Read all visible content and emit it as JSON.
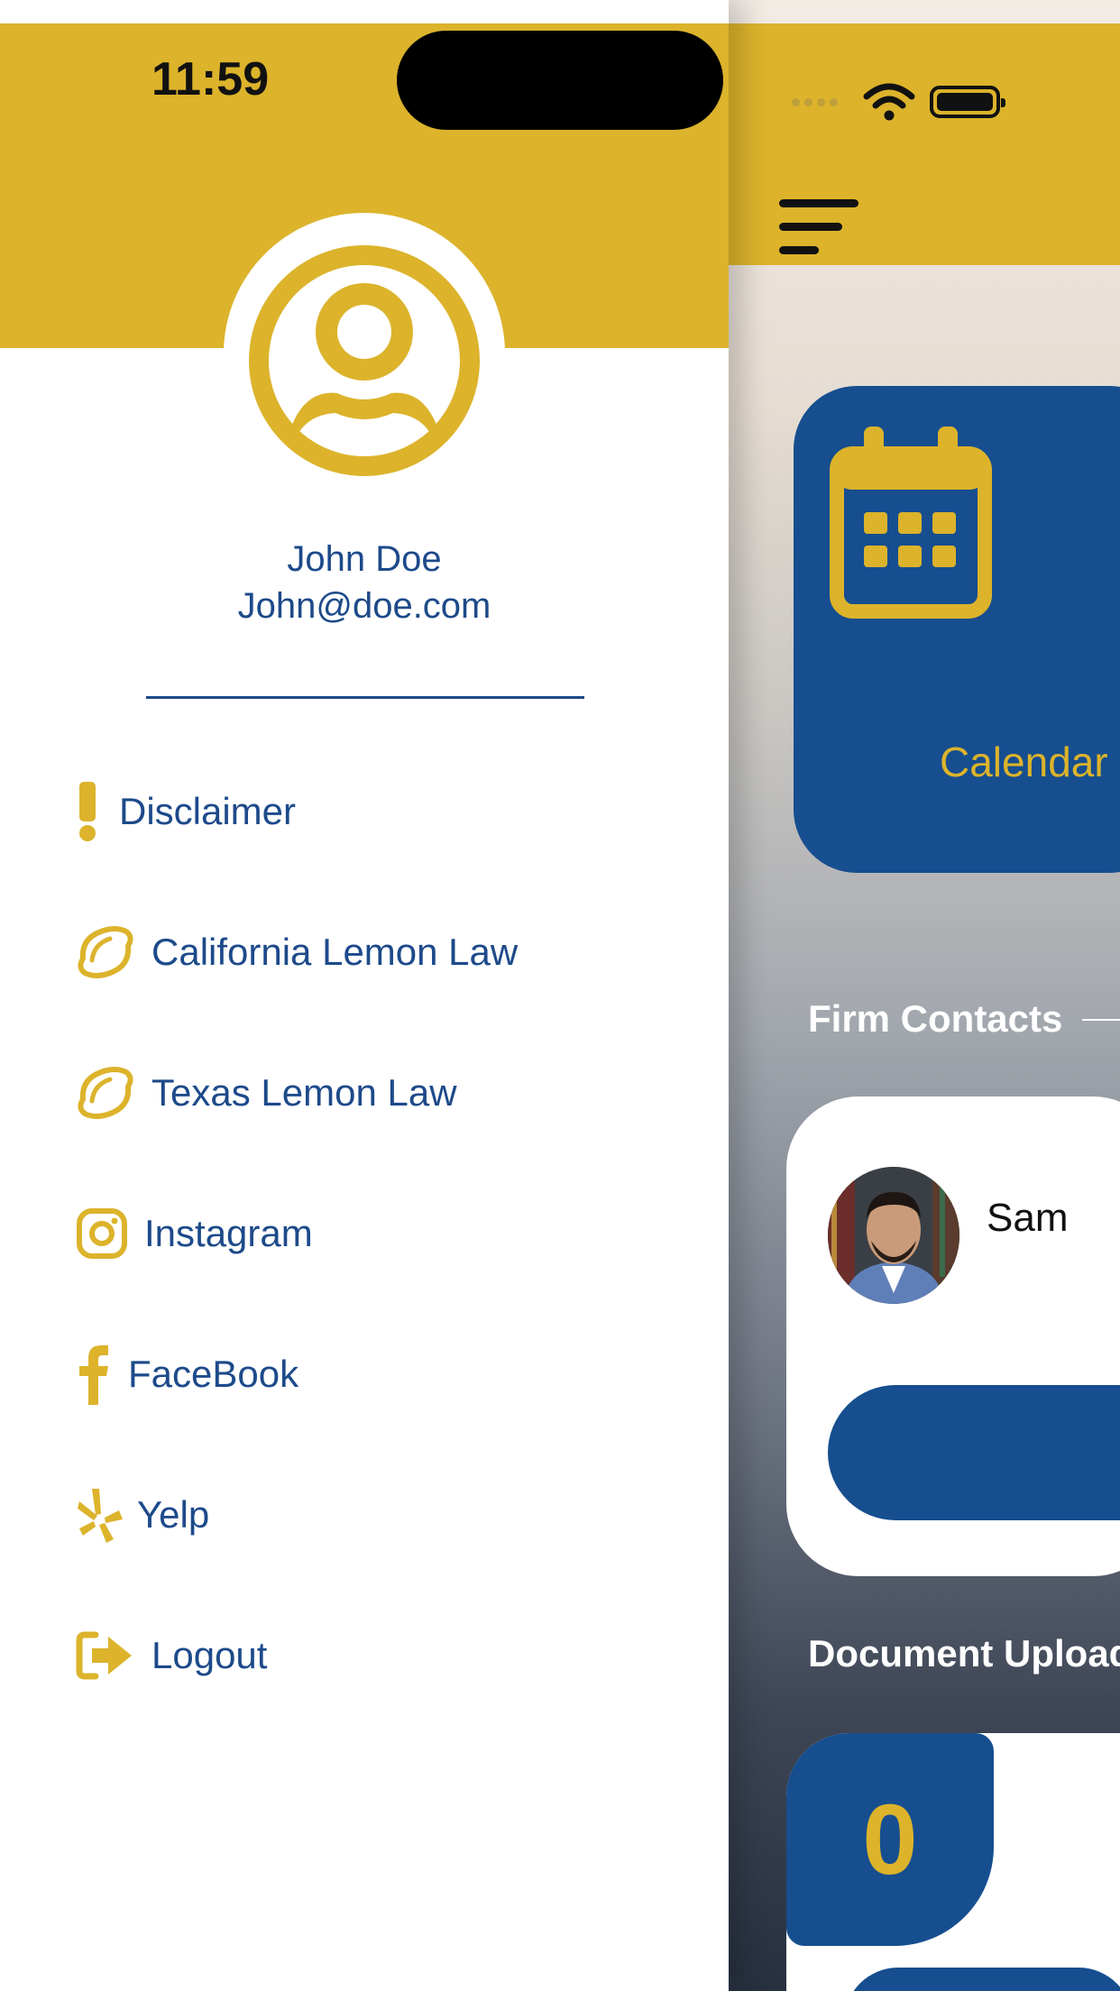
{
  "status_bar": {
    "time": "11:59"
  },
  "drawer": {
    "user": {
      "name": "John Doe",
      "email": "John@doe.com"
    },
    "menu": [
      {
        "label": "Disclaimer",
        "icon": "exclamation-icon"
      },
      {
        "label": "California Lemon Law",
        "icon": "lemon-icon"
      },
      {
        "label": "Texas Lemon Law",
        "icon": "lemon-icon"
      },
      {
        "label": "Instagram",
        "icon": "instagram-icon"
      },
      {
        "label": "FaceBook",
        "icon": "facebook-icon"
      },
      {
        "label": "Yelp",
        "icon": "yelp-icon"
      },
      {
        "label": "Logout",
        "icon": "logout-icon"
      }
    ]
  },
  "main": {
    "calendar_label": "Calendar",
    "firm_contacts_title": "Firm Contacts",
    "contact_name": "Sam",
    "document_uploads_title": "Document Uploads",
    "document_count": "0"
  },
  "colors": {
    "brand_gold": "#dcb32b",
    "brand_blue": "#164e8f",
    "text_blue": "#1d4a8a"
  }
}
